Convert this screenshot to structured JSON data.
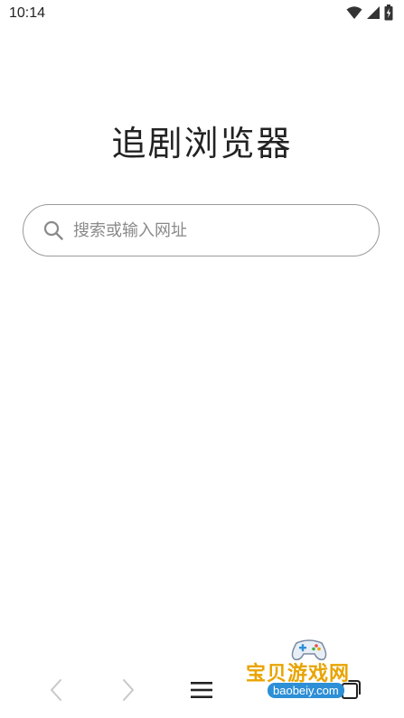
{
  "status_bar": {
    "time": "10:14",
    "icons": [
      "wifi-icon",
      "signal-icon",
      "battery-charging-icon"
    ]
  },
  "app": {
    "title": "追剧浏览器"
  },
  "search": {
    "placeholder": "搜索或输入网址",
    "value": "",
    "icon": "search-icon"
  },
  "bottom_nav": {
    "items": [
      {
        "name": "back",
        "icon": "chevron-left-icon",
        "enabled": false
      },
      {
        "name": "forward",
        "icon": "chevron-right-icon",
        "enabled": false
      },
      {
        "name": "menu",
        "icon": "hamburger-menu-icon",
        "enabled": true
      },
      {
        "name": "windows",
        "icon": "windows-icon",
        "enabled": true
      }
    ]
  },
  "watermark": {
    "text": "宝贝游戏网",
    "url": "baobeiy.com"
  },
  "colors": {
    "text": "#222222",
    "placeholder": "#8a8a8a",
    "border": "#9a9a9a",
    "disabled_icon": "#c8c8c8",
    "watermark_gold": "#e8a400",
    "watermark_blue": "#2d8fd6"
  }
}
